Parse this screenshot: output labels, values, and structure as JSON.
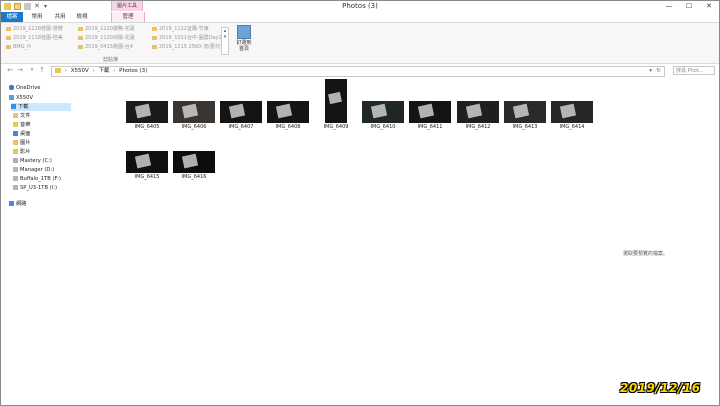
{
  "window": {
    "title": "Photos (3)",
    "controls": [
      "—",
      "☐",
      "✕"
    ]
  },
  "ribbon": {
    "context_header": "圖片工具",
    "tabs": [
      "檔案",
      "常用",
      "共用",
      "檢視",
      "管理"
    ],
    "pinned": [
      [
        "2019_1118桂園-誉櫻",
        "2019_1118桂園-桂美",
        "BMG_H"
      ],
      [
        "2019_1120燉鴨-花蓮",
        "2019_1120圳陽-花蓮",
        "2019_0415桃園-台4"
      ],
      [
        "2019_1122宜蘭-竹東",
        "2019_1011台中-圓農Day2",
        "2019_1215 2560-流(舊代)"
      ]
    ],
    "group_label": "剪貼簿",
    "pin_button_label": "釘選到\n首頁"
  },
  "address": {
    "crumbs": [
      "X550V",
      "下載",
      "Photos (3)"
    ],
    "search_placeholder": "搜尋 Phot..."
  },
  "nav": {
    "items": [
      {
        "label": "OneDrive",
        "icon": "cloud-icon"
      },
      {
        "label": "X550V",
        "icon": "computer-icon"
      },
      {
        "label": "下載",
        "icon": "downloads-icon",
        "selected": true
      },
      {
        "label": "文件",
        "icon": "folder-icon"
      },
      {
        "label": "音樂",
        "icon": "music-icon"
      },
      {
        "label": "桌面",
        "icon": "desktop-icon"
      },
      {
        "label": "圖片",
        "icon": "pictures-icon"
      },
      {
        "label": "影片",
        "icon": "video-icon"
      },
      {
        "label": "Mastery (C:)",
        "icon": "drive-icon"
      },
      {
        "label": "Manager (D:)",
        "icon": "drive-icon"
      },
      {
        "label": "Buffalo_1TB (F:)",
        "icon": "drive-icon"
      },
      {
        "label": "SP_U3-1TB (I:)",
        "icon": "drive-icon"
      },
      {
        "label": "網路",
        "icon": "network-icon"
      }
    ]
  },
  "files": [
    "IMG_6405",
    "IMG_6406",
    "IMG_6407",
    "IMG_6408",
    "IMG_6409",
    "IMG_6410",
    "IMG_6411",
    "IMG_6412",
    "IMG_6413",
    "IMG_6414",
    "IMG_6415",
    "IMG_6416"
  ],
  "preview_text": "選取要預覽的檔案。",
  "date_stamp": "2019/12/16",
  "colors": {
    "file_tab": "#1979ca",
    "context": "#f3d6e6",
    "stamp": "#ffd400"
  }
}
